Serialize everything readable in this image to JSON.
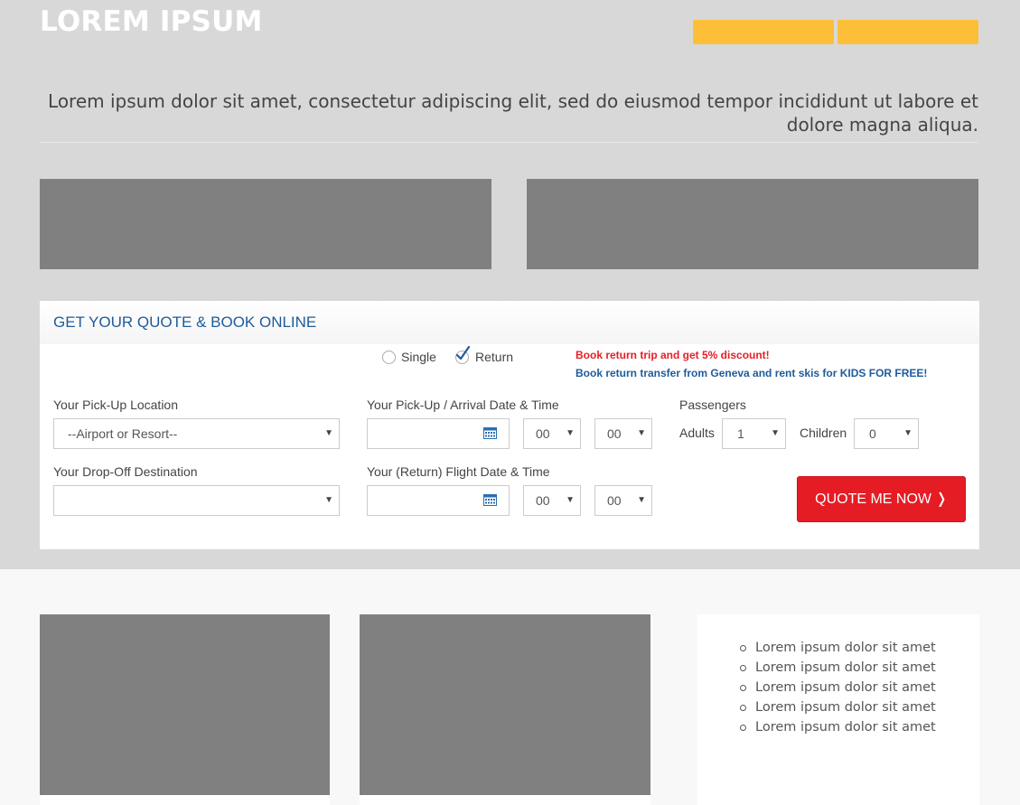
{
  "header": {
    "site_title": "LOREM IPSUM",
    "tagline": "Lorem ipsum dolor sit amet, consectetur adipiscing elit, sed do eiusmod tempor incididunt ut labore et dolore magna aliqua.",
    "accent_color": "#fdbf38"
  },
  "quote_form": {
    "title": "GET YOUR QUOTE & BOOK ONLINE",
    "trip_type": {
      "single_label": "Single",
      "return_label": "Return",
      "selected": "Return"
    },
    "promo_discount": "Book return trip and get 5% discount!",
    "promo_kids": "Book return transfer from Geneva and rent skis for KIDS FOR FREE!",
    "pickup_location_label": "Your Pick-Up Location",
    "pickup_location_value": "--Airport or Resort--",
    "pickup_datetime_label": "Your Pick-Up / Arrival Date & Time",
    "pickup_date_value": "",
    "pickup_hour": "00",
    "pickup_minute": "00",
    "passengers_label": "Passengers",
    "adults_label": "Adults",
    "adults_value": "1",
    "children_label": "Children",
    "children_value": "0",
    "dropoff_label": "Your Drop-Off Destination",
    "dropoff_value": "",
    "return_datetime_label": "Your (Return) Flight Date & Time",
    "return_date_value": "",
    "return_hour": "00",
    "return_minute": "00",
    "submit_label": "QUOTE ME NOW ❭",
    "title_color": "#1f5b9a",
    "button_color": "#e51c24"
  },
  "sidebar_list": {
    "items": [
      "Lorem ipsum dolor sit amet",
      "Lorem ipsum dolor sit amet",
      "Lorem ipsum dolor sit amet",
      "Lorem ipsum dolor sit amet",
      "Lorem ipsum dolor sit amet"
    ]
  }
}
